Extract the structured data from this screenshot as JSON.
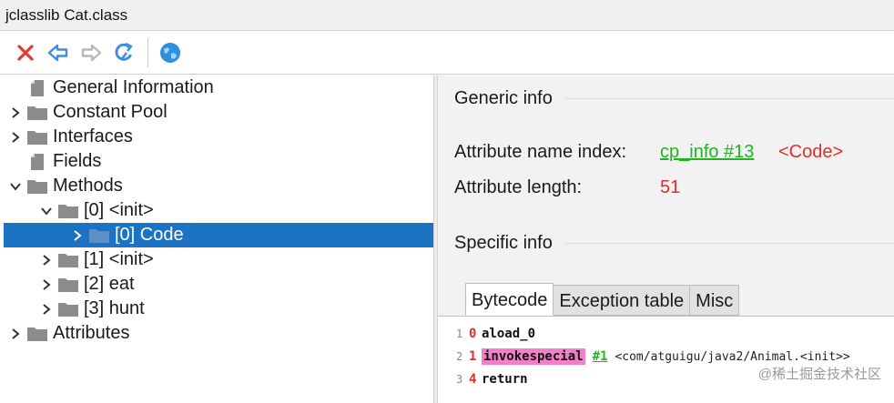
{
  "window": {
    "title": "jclasslib Cat.class"
  },
  "toolbar": {
    "buttons": [
      {
        "name": "close",
        "icon": "close-x-icon",
        "color": "#e03c31"
      },
      {
        "name": "back",
        "icon": "arrow-left-icon",
        "color": "#3d8ee0"
      },
      {
        "name": "forward",
        "icon": "arrow-right-icon",
        "color": "#b8b8b8"
      },
      {
        "name": "reload",
        "icon": "refresh-icon",
        "color": "#3d8ee0"
      },
      {
        "name": "browser",
        "icon": "globe-icon",
        "color": "#2f8fdc"
      }
    ]
  },
  "tree": {
    "items": [
      {
        "label": "General Information",
        "level": 0,
        "expander": "none",
        "icon": "document-icon"
      },
      {
        "label": "Constant Pool",
        "level": 0,
        "expander": "collapsed",
        "icon": "folder-icon"
      },
      {
        "label": "Interfaces",
        "level": 0,
        "expander": "collapsed",
        "icon": "folder-icon"
      },
      {
        "label": "Fields",
        "level": 0,
        "expander": "none",
        "icon": "document-icon"
      },
      {
        "label": "Methods",
        "level": 0,
        "expander": "expanded",
        "icon": "folder-icon"
      },
      {
        "label": "[0] <init>",
        "level": 1,
        "expander": "expanded",
        "icon": "folder-icon"
      },
      {
        "label": "[0] Code",
        "level": 2,
        "expander": "collapsed",
        "icon": "folder-icon",
        "selected": true
      },
      {
        "label": "[1] <init>",
        "level": 1,
        "expander": "collapsed",
        "icon": "folder-icon"
      },
      {
        "label": "[2] eat",
        "level": 1,
        "expander": "collapsed",
        "icon": "folder-icon"
      },
      {
        "label": "[3] hunt",
        "level": 1,
        "expander": "collapsed",
        "icon": "folder-icon"
      },
      {
        "label": "Attributes",
        "level": 0,
        "expander": "collapsed",
        "icon": "folder-icon"
      }
    ]
  },
  "detail": {
    "generic_title": "Generic info",
    "name_index_label": "Attribute name index:",
    "name_index_link": "cp_info #13",
    "name_index_value": "<Code>",
    "length_label": "Attribute length:",
    "length_value": "51",
    "specific_title": "Specific info",
    "tabs": [
      "Bytecode",
      "Exception table",
      "Misc"
    ],
    "active_tab": 0,
    "bytecode": [
      {
        "line": "1",
        "offset": "0",
        "op": "aload_0",
        "highlight": false,
        "ref": "",
        "comment": ""
      },
      {
        "line": "2",
        "offset": "1",
        "op": "invokespecial",
        "highlight": true,
        "ref": "#1",
        "comment": "<com/atguigu/java2/Animal.<init>>"
      },
      {
        "line": "3",
        "offset": "4",
        "op": "return",
        "highlight": false,
        "ref": "",
        "comment": ""
      }
    ]
  },
  "colors": {
    "selection": "#1c73c4",
    "link_green": "#21b421",
    "value_red": "#e12d2d",
    "opcode_highlight": "#f37fc8"
  },
  "watermark": "@稀土掘金技术社区"
}
